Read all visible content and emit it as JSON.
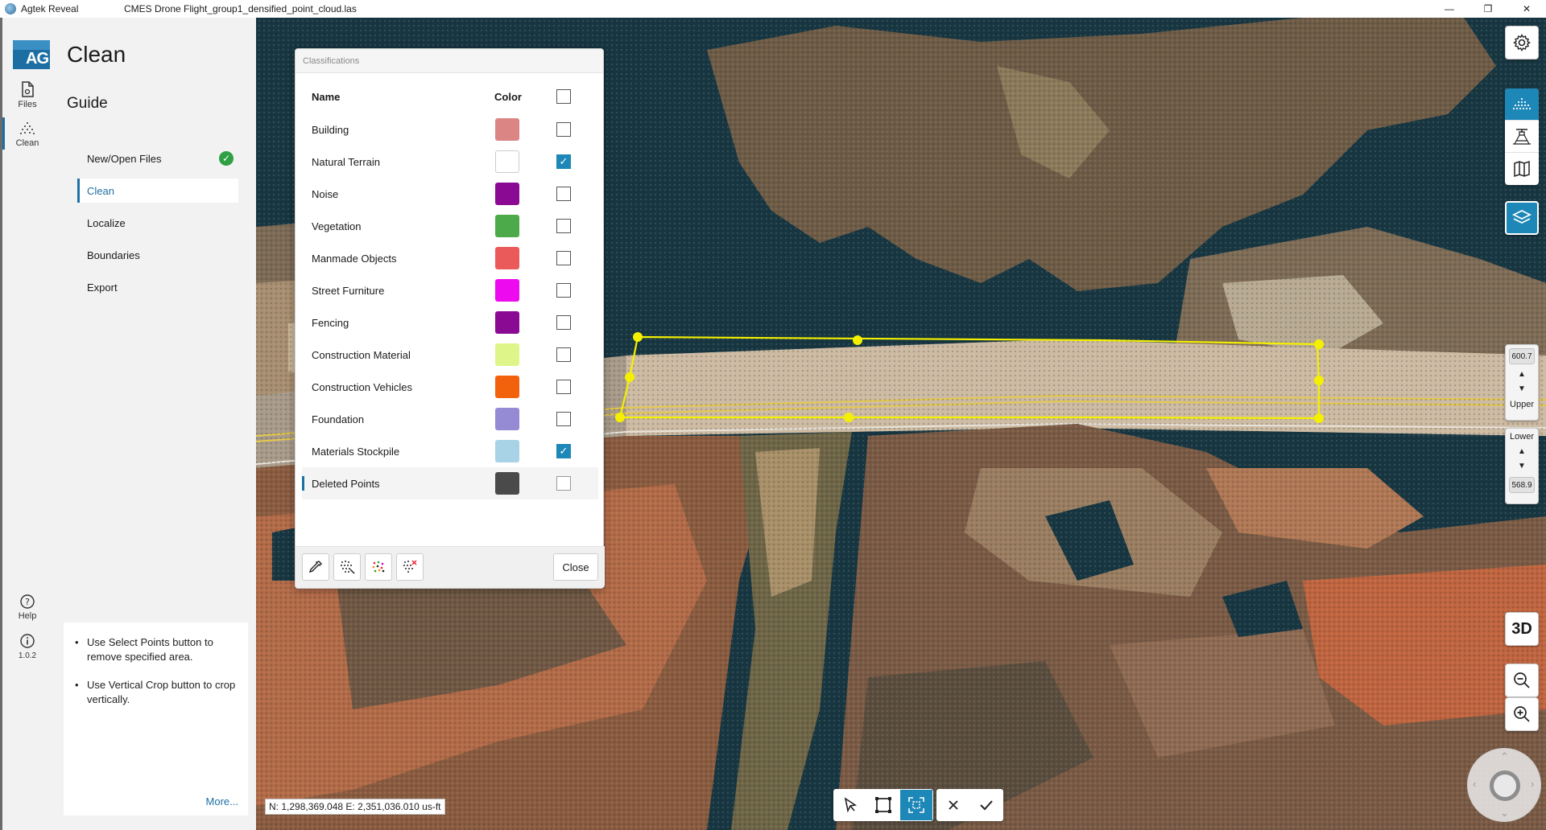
{
  "titlebar": {
    "app_name": "Agtek Reveal",
    "file_name": "CMES Drone Flight_group1_densified_point_cloud.las",
    "minimize": "—",
    "maximize": "❐",
    "close": "✕"
  },
  "rail": {
    "logo": "AG",
    "files_label": "Files",
    "clean_label": "Clean",
    "help_label": "Help",
    "version": "1.0.2"
  },
  "guide": {
    "section_title": "Clean",
    "title": "Guide",
    "steps": [
      {
        "label": "New/Open Files",
        "done": true
      },
      {
        "label": "Clean",
        "active": true
      },
      {
        "label": "Localize"
      },
      {
        "label": "Boundaries"
      },
      {
        "label": "Export"
      }
    ],
    "tips": [
      "Use Select Points button to remove specified area.",
      "Use Vertical Crop button to crop vertically."
    ],
    "more_link": "More..."
  },
  "classifications": {
    "title": "Classifications",
    "col_name": "Name",
    "col_color": "Color",
    "rows": [
      {
        "name": "Building",
        "color": "#db8585",
        "checked": false
      },
      {
        "name": "Natural Terrain",
        "color": "#ffffff",
        "checked": true
      },
      {
        "name": "Noise",
        "color": "#8b0a93",
        "checked": false
      },
      {
        "name": "Vegetation",
        "color": "#4caa4a",
        "checked": false
      },
      {
        "name": "Manmade Objects",
        "color": "#ea5a5a",
        "checked": false
      },
      {
        "name": "Street Furniture",
        "color": "#ee0aee",
        "checked": false
      },
      {
        "name": "Fencing",
        "color": "#8b0a93",
        "checked": false
      },
      {
        "name": "Construction Material",
        "color": "#def58a",
        "checked": false
      },
      {
        "name": "Construction Vehicles",
        "color": "#f2620c",
        "checked": false
      },
      {
        "name": "Foundation",
        "color": "#958ad4",
        "checked": false
      },
      {
        "name": "Materials Stockpile",
        "color": "#a8d2e6",
        "checked": true
      },
      {
        "name": "Deleted Points",
        "color": "#4a4a4a",
        "checked": false,
        "selected": true
      }
    ],
    "close_label": "Close"
  },
  "elevation": {
    "upper_value": "600.7",
    "upper_label": "Upper",
    "lower_label": "Lower",
    "lower_value": "568.9"
  },
  "view_mode_label": "3D",
  "coordinates": "N: 1,298,369.048 E: 2,351,036.010 us-ft",
  "colors": {
    "accent": "#1d87b8",
    "selection_polygon": "#f5f000",
    "success": "#2ea043"
  }
}
